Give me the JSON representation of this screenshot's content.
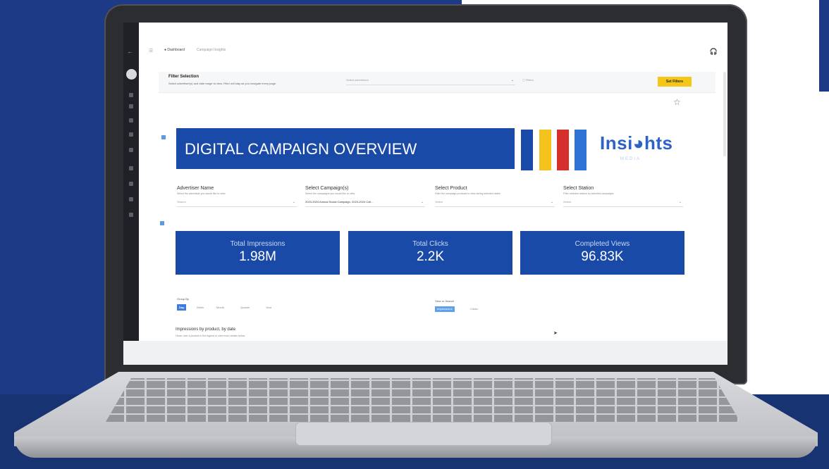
{
  "breadcrumb": {
    "home": "● Dashboard",
    "current": "Campaign Insights"
  },
  "filter_bar": {
    "title": "Filter Selection",
    "subtitle": "Select advertiser(s) and date range to view. Filter will stay as you navigate every page.",
    "advertiser_placeholder": "Select advertisers",
    "date_label": "Filters",
    "button": "Set Filters"
  },
  "banner": {
    "title": "DIGITAL CAMPAIGN OVERVIEW",
    "logo": "Insi◕hts",
    "logo_sub": "MEDIA",
    "bar_colors": [
      "#1a4aa8",
      "#f3c21c",
      "#d6302c",
      "#2d73d6"
    ]
  },
  "selectors": [
    {
      "label": "Advertiser Name",
      "help": "Select the advertiser you would like to view",
      "value": "Search"
    },
    {
      "label": "Select Campaign(s)",
      "help": "Select the campaigns you would like to view",
      "value": "2023-2024 Annual Social Campaign, 2023-2024 Coll..."
    },
    {
      "label": "Select Product",
      "help": "Filter the campaign products to view during selected dates",
      "value": "Select"
    },
    {
      "label": "Select Station",
      "help": "Filter selected station by selected campaigns",
      "value": "Select"
    }
  ],
  "kpis": [
    {
      "label": "Total Impressions",
      "value": "1.98M"
    },
    {
      "label": "Total Clicks",
      "value": "2.2K"
    },
    {
      "label": "Completed Views",
      "value": "96.83K"
    }
  ],
  "group_by": {
    "label": "Group By",
    "options": [
      "Day",
      "Week",
      "Month",
      "Quarter",
      "Year"
    ],
    "selected": "Day"
  },
  "view_by": {
    "label": "View or Search",
    "options": [
      "Impressions",
      "Clicks"
    ],
    "selected": "Impressions"
  },
  "section": {
    "title": "Impressions by product, by date",
    "subtitle": "Hover over a product in the legend to view more details below"
  },
  "colors": {
    "kpi_bg": "#1a4aa8",
    "accent_yellow": "#f5c518",
    "background_blue": "#1d3a86"
  }
}
